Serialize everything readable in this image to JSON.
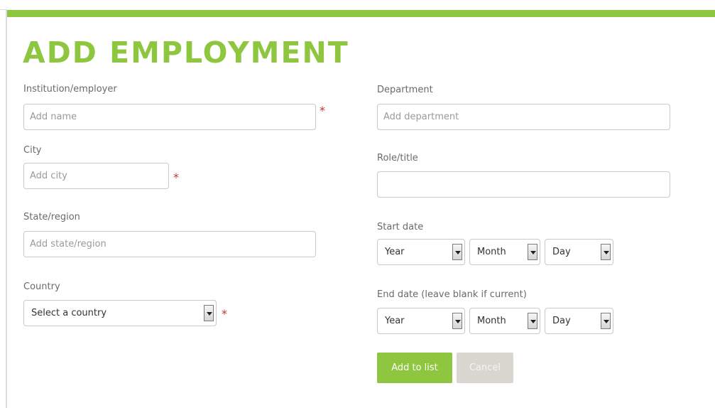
{
  "page": {
    "title": "ADD EMPLOYMENT"
  },
  "form": {
    "institution": {
      "label": "Institution/employer",
      "placeholder": "Add name",
      "required_mark": "*"
    },
    "city": {
      "label": "City",
      "placeholder": "Add city",
      "required_mark": "*"
    },
    "state": {
      "label": "State/region",
      "placeholder": "Add state/region"
    },
    "country": {
      "label": "Country",
      "selected": "Select a country",
      "required_mark": "*"
    },
    "department": {
      "label": "Department",
      "placeholder": "Add department"
    },
    "role": {
      "label": "Role/title",
      "placeholder": ""
    },
    "start_date": {
      "label": "Start date",
      "year": "Year",
      "month": "Month",
      "day": "Day"
    },
    "end_date": {
      "label": "End date (leave blank if current)",
      "year": "Year",
      "month": "Month",
      "day": "Day"
    },
    "buttons": {
      "add": "Add to list",
      "cancel": "Cancel"
    }
  },
  "colors": {
    "accent": "#8ec63f",
    "required": "#c0392b",
    "cancel_bg": "#d9d6cf"
  },
  "icons": {
    "select_arrow": "chevron-down-icon"
  }
}
